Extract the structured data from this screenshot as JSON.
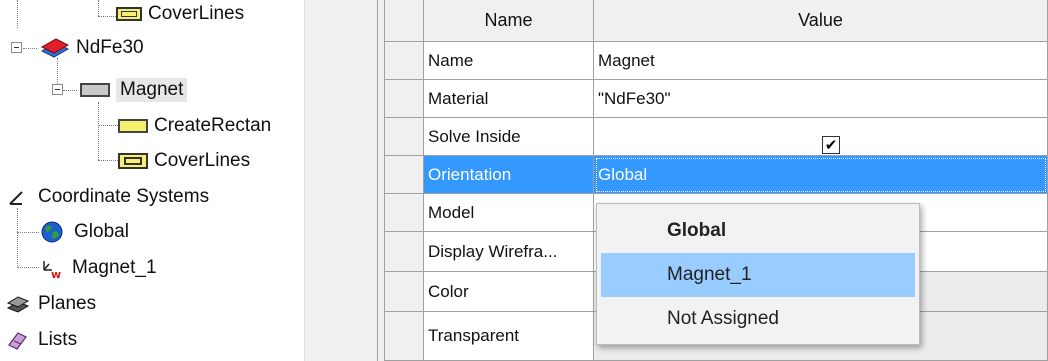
{
  "tree": {
    "items": [
      {
        "label": "CoverLines"
      },
      {
        "label": "NdFe30"
      },
      {
        "label": "Magnet"
      },
      {
        "label": "CreateRectan"
      },
      {
        "label": "CoverLines"
      },
      {
        "label": "Coordinate Systems"
      },
      {
        "label": "Global"
      },
      {
        "label": "Magnet_1"
      },
      {
        "label": "Planes"
      },
      {
        "label": "Lists"
      }
    ]
  },
  "grid": {
    "headers": {
      "name": "Name",
      "value": "Value"
    },
    "rows": [
      {
        "name": "Name",
        "value": "Magnet"
      },
      {
        "name": "Material",
        "value": "\"NdFe30\""
      },
      {
        "name": "Solve Inside",
        "value": "",
        "checked": true
      },
      {
        "name": "Orientation",
        "value": "Global"
      },
      {
        "name": "Model",
        "value": ""
      },
      {
        "name": "Display Wirefra...",
        "value": ""
      },
      {
        "name": "Color",
        "value": ""
      },
      {
        "name": "Transparent",
        "value": ""
      }
    ],
    "checkbox_mark": "✔"
  },
  "dropdown": {
    "options": [
      {
        "label": "Global"
      },
      {
        "label": "Magnet_1"
      },
      {
        "label": "Not Assigned"
      }
    ]
  },
  "colors": {
    "selection": "#3399ff",
    "hover": "#99ccff",
    "material_red": "#e0202a",
    "material_blue": "#2a6fd6",
    "folder_yellow": "#f7f06e"
  }
}
